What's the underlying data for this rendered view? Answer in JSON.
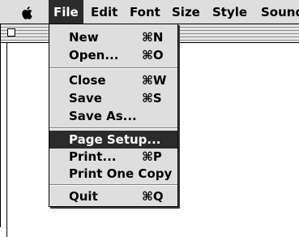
{
  "menubar": {
    "menus": [
      "File",
      "Edit",
      "Font",
      "Size",
      "Style",
      "Sound"
    ],
    "active": "File",
    "apple_icon": "apple-icon"
  },
  "file_menu": {
    "items": [
      {
        "label": "New",
        "shortcut": "⌘N"
      },
      {
        "label": "Open...",
        "shortcut": "⌘O"
      },
      {
        "label": "Close",
        "shortcut": "⌘W"
      },
      {
        "label": "Save",
        "shortcut": "⌘S"
      },
      {
        "label": "Save As...",
        "shortcut": ""
      },
      {
        "label": "Page Setup...",
        "shortcut": "",
        "selected": true
      },
      {
        "label": "Print...",
        "shortcut": "⌘P"
      },
      {
        "label": "Print One Copy",
        "shortcut": ""
      },
      {
        "label": "Quit",
        "shortcut": "⌘Q"
      }
    ]
  },
  "colors": {
    "menu_background": "#dedede",
    "highlight": "#2b2b2b"
  }
}
